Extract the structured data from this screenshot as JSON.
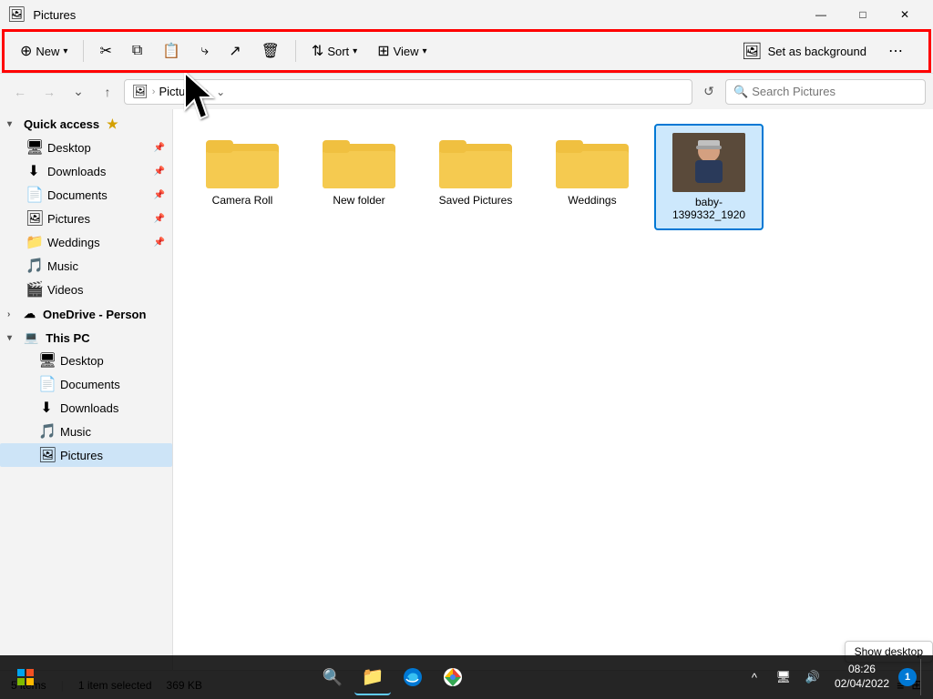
{
  "window": {
    "title": "Pictures",
    "titleIcon": "🖼"
  },
  "toolbar": {
    "new_label": "New",
    "sort_label": "Sort",
    "view_label": "View",
    "set_bg_label": "Set as background"
  },
  "addressbar": {
    "path_parts": [
      "",
      "Pictures",
      ""
    ],
    "search_placeholder": "Search Pictures"
  },
  "sidebar": {
    "quick_access_label": "Quick access",
    "quick_access_items": [
      {
        "label": "Desktop",
        "icon": "🖥",
        "pinned": true
      },
      {
        "label": "Downloads",
        "icon": "⬇",
        "pinned": true
      },
      {
        "label": "Documents",
        "icon": "📄",
        "pinned": true
      },
      {
        "label": "Pictures",
        "icon": "🖼",
        "pinned": true
      },
      {
        "label": "Weddings",
        "icon": "📁",
        "pinned": true
      }
    ],
    "other_items": [
      {
        "label": "Music",
        "icon": "🎵"
      },
      {
        "label": "Videos",
        "icon": "🎬"
      }
    ],
    "onedrive_label": "OneDrive - Person",
    "thispc_label": "This PC",
    "thispc_items": [
      {
        "label": "Desktop",
        "icon": "🖥"
      },
      {
        "label": "Documents",
        "icon": "📄"
      },
      {
        "label": "Downloads",
        "icon": "⬇"
      },
      {
        "label": "Music",
        "icon": "🎵"
      },
      {
        "label": "Pictures",
        "icon": "🖼",
        "active": true
      }
    ]
  },
  "content": {
    "folders": [
      {
        "name": "Camera Roll"
      },
      {
        "name": "New folder"
      },
      {
        "name": "Saved Pictures"
      },
      {
        "name": "Weddings"
      }
    ],
    "file": {
      "name": "baby-1399332_1920"
    }
  },
  "statusbar": {
    "item_count": "5 items",
    "selected": "1 item selected",
    "size": "369 KB"
  },
  "taskbar": {
    "time": "08:26",
    "date": "02/04/2022"
  },
  "show_desktop": "Show desktop"
}
